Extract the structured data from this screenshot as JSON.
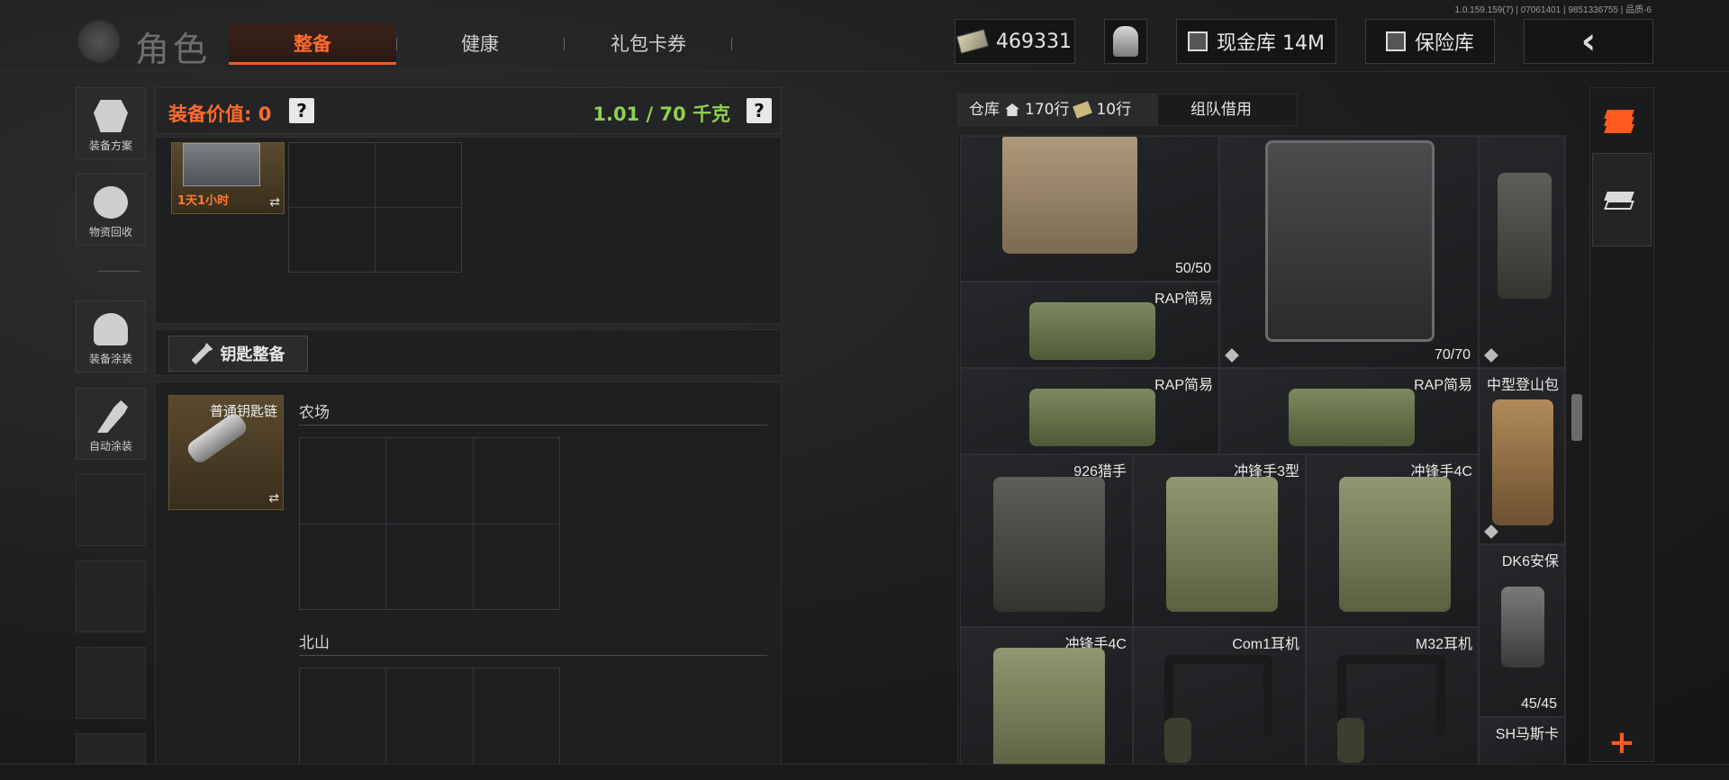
{
  "build_info": "1.0.159.159(7) | 07061401 | 9851336755 | 品质-6",
  "header": {
    "title": "角色",
    "tabs": [
      {
        "label": "整备",
        "active": true
      },
      {
        "label": "健康",
        "active": false
      },
      {
        "label": "礼包卡券",
        "active": false
      }
    ],
    "money": "469331",
    "cash_vault": "现金库 14M",
    "safe_vault": "保险库",
    "accent_color": "#ff5a1f"
  },
  "sidebar": {
    "items": [
      {
        "label": "装备方案",
        "icon": "equipment-plan-icon"
      },
      {
        "label": "物资回收",
        "icon": "recycle-icon"
      },
      {
        "label": "装备涂装",
        "icon": "helmet-paint-icon"
      },
      {
        "label": "自动涂装",
        "icon": "auto-paint-icon"
      }
    ]
  },
  "equipment": {
    "value_label": "装备价值: 0",
    "weight": "1.01 / 70 千克",
    "help": "?",
    "case_timer": "1天1小时",
    "swap_icon": "⇄",
    "key_button": "钥匙整备",
    "keychain_name": "普通钥匙链",
    "maps": [
      "农场",
      "北山"
    ]
  },
  "stash": {
    "tabs": [
      {
        "label": "仓库",
        "active": true
      },
      {
        "label": "170行",
        "icon": "home-icon"
      },
      {
        "label": "10行",
        "icon": "cash-icon"
      },
      {
        "label": "组队借用",
        "active": false
      }
    ],
    "items": [
      {
        "name": "",
        "count": "50/50",
        "art": "vest-tan"
      },
      {
        "name": "",
        "count": "70/70",
        "art": "vest-dark"
      },
      {
        "name": "",
        "count": "",
        "art": "bag-dark"
      },
      {
        "name": "RAP简易",
        "count": "",
        "art": "roll"
      },
      {
        "name": "RAP简易",
        "count": "",
        "art": "roll"
      },
      {
        "name": "RAP简易",
        "count": "",
        "art": "roll"
      },
      {
        "name": "中型登山包",
        "count": "",
        "art": "pack"
      },
      {
        "name": "926猎手",
        "count": "",
        "art": "bag-dark"
      },
      {
        "name": "冲锋手3型",
        "count": "",
        "art": "bag-green"
      },
      {
        "name": "冲锋手4C",
        "count": "",
        "art": "bag-green"
      },
      {
        "name": "DK6安保",
        "count": "45/45",
        "art": "guard"
      },
      {
        "name": "冲锋手4C",
        "count": "",
        "art": "bag-green"
      },
      {
        "name": "Com1耳机",
        "count": "",
        "art": "headset"
      },
      {
        "name": "M32耳机",
        "count": "",
        "art": "headset"
      },
      {
        "name": "SH马斯卡",
        "count": "",
        "art": "guard"
      }
    ]
  },
  "tools": {
    "plus_label": "+"
  }
}
